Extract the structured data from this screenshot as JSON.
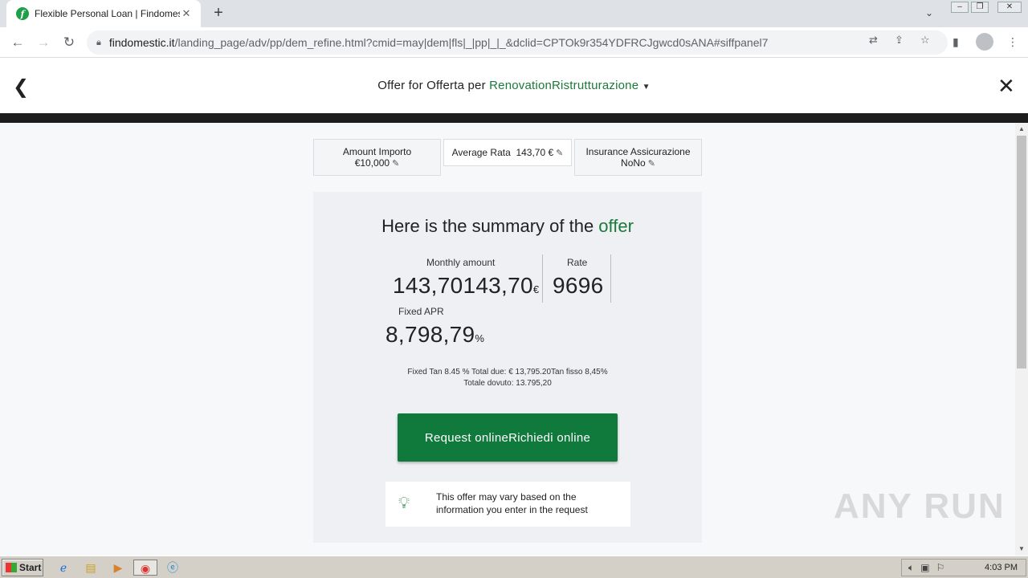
{
  "browser": {
    "tab_title": "Flexible Personal Loan | Findomestic",
    "favicon_letter": "f",
    "url_host": "findomestic.it",
    "url_path": "/landing_page/adv/pp/dem_refine.html?cmid=may|dem|fls|_|pp|_|_&dclid=CPTOk9r354YDFRCJgwcd0sANA#siffpanel7"
  },
  "header": {
    "title_prefix": "Offer for Offerta per ",
    "title_accent": "RenovationRistrutturazione"
  },
  "params": {
    "amount_label": "Amount Importo",
    "amount_value": "€10,000",
    "rate_label": "Average Rata",
    "rate_value": "143,70 €",
    "insurance_label": "Insurance Assicurazione",
    "insurance_value": "NoNo"
  },
  "summary": {
    "title_prefix": "Here is the summary of the ",
    "title_accent": "offer",
    "monthly_label": "Monthly amount",
    "monthly_value": "143,70143,70",
    "monthly_unit": "€",
    "rate_label": "Rate",
    "rate_value": "9696",
    "apr_label": "Fixed APR",
    "apr_value": "8,798,79",
    "apr_unit": "%",
    "note_line1": "Fixed Tan 8.45 % Total due: € 13,795.20Tan fisso 8,45%",
    "note_line2": "Totale dovuto: 13.795,20",
    "cta_label": "Request onlineRichiedi online",
    "info_text": "This offer may vary based on the information you enter in the request"
  },
  "watermark": "ANY RUN",
  "taskbar": {
    "start_label": "Start",
    "clock": "4:03 PM"
  },
  "colors": {
    "brand_green": "#107a3c",
    "accent_green": "#1b7a3a"
  }
}
